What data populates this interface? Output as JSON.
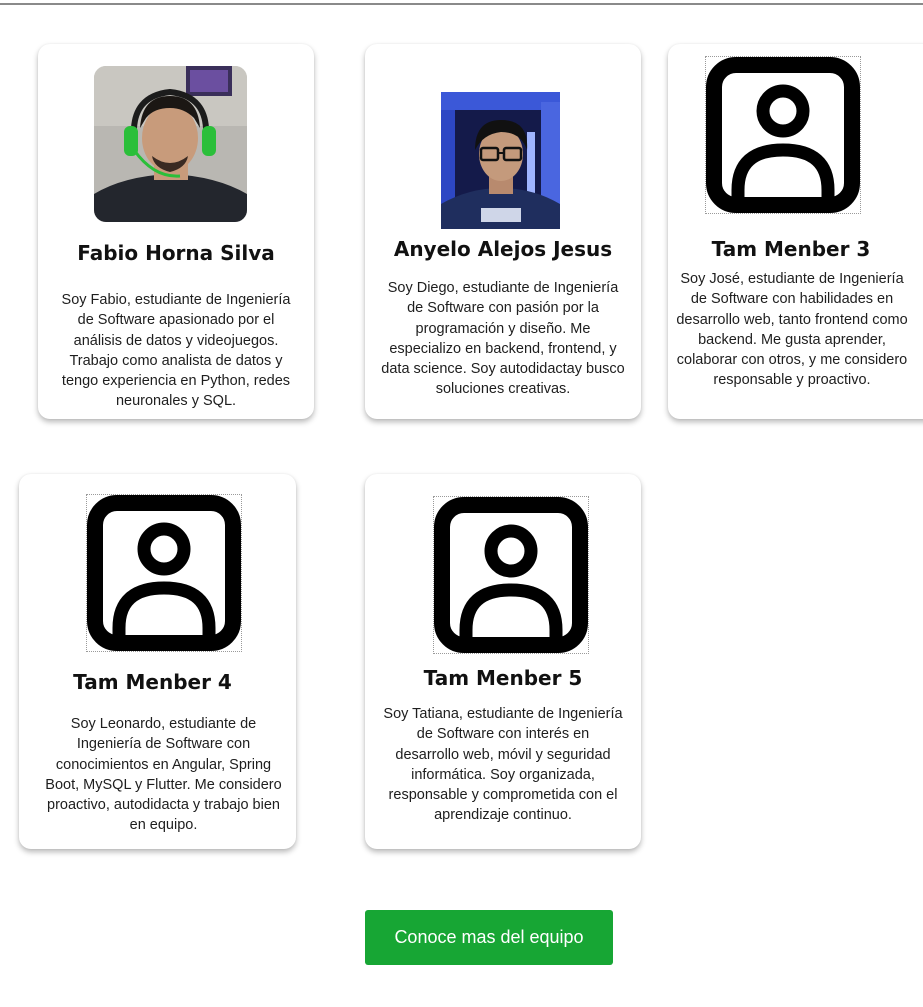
{
  "team": [
    {
      "name": "Fabio Horna Silva",
      "description": "Soy Fabio, estudiante de Ingeniería de Software apasionado por el análisis de datos y videojuegos. Trabajo como analista de datos y tengo experiencia en Python, redes neuronales y SQL.",
      "image": "member-photo"
    },
    {
      "name": "Anyelo Alejos Jesus",
      "description": "Soy Diego, estudiante de Ingeniería de Software con pasión por la programación y diseño. Me especializo en backend, frontend, y data science. Soy autodidactay busco soluciones creativas.",
      "image": "member-photo"
    },
    {
      "name": "Tam Menber 3",
      "description": "Soy José, estudiante de Ingeniería de Software con habilidades en desarrollo web, tanto frontend como backend. Me gusta aprender, colaborar con otros, y me considero responsable y proactivo.",
      "image": "user-placeholder-icon"
    },
    {
      "name": "Tam Menber 4",
      "description": "Soy Leonardo, estudiante de Ingeniería de Software con conocimientos en Angular, Spring Boot, MySQL y Flutter. Me considero proactivo, autodidacta y trabajo bien en equipo.",
      "image": "user-placeholder-icon"
    },
    {
      "name": "Tam Menber 5",
      "description": "Soy Tatiana, estudiante de Ingeniería de Software con interés en desarrollo web, móvil y seguridad informática. Soy organizada, responsable y comprometida con el aprendizaje continuo.",
      "image": "user-placeholder-icon"
    }
  ],
  "cta": {
    "label": "Conoce mas del equipo"
  },
  "colors": {
    "accent": "#17a634",
    "text": "#111111",
    "card": "#ffffff"
  }
}
